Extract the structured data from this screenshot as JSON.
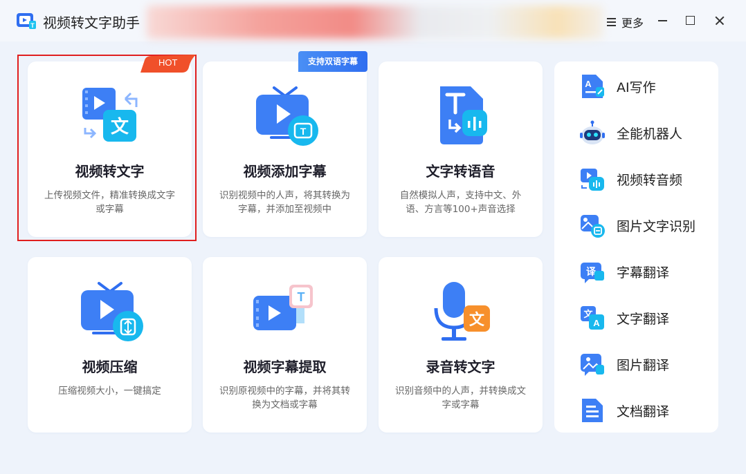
{
  "app": {
    "title": "视频转文字助手",
    "more_label": "更多"
  },
  "cards": [
    {
      "title": "视频转文字",
      "desc": "上传视频文件，精准转换成文字或字幕",
      "badge": "HOT"
    },
    {
      "title": "视频添加字幕",
      "desc": "识别视频中的人声，将其转换为字幕，并添加至视频中",
      "badge": "支持双语字幕"
    },
    {
      "title": "文字转语音",
      "desc": "自然模拟人声，支持中文、外语、方言等100+声音选择"
    },
    {
      "title": "视频压缩",
      "desc": "压缩视频大小，一键搞定"
    },
    {
      "title": "视频字幕提取",
      "desc": "识别原视频中的字幕，并将其转换为文档或字幕"
    },
    {
      "title": "录音转文字",
      "desc": "识别音频中的人声，并转换成文字或字幕"
    }
  ],
  "side_items": [
    {
      "label": "AI写作",
      "icon": "ai-writing-icon"
    },
    {
      "label": "全能机器人",
      "icon": "robot-icon"
    },
    {
      "label": "视频转音频",
      "icon": "video-to-audio-icon"
    },
    {
      "label": "图片文字识别",
      "icon": "image-ocr-icon"
    },
    {
      "label": "字幕翻译",
      "icon": "subtitle-translate-icon"
    },
    {
      "label": "文字翻译",
      "icon": "text-translate-icon"
    },
    {
      "label": "图片翻译",
      "icon": "image-translate-icon"
    },
    {
      "label": "文档翻译",
      "icon": "document-translate-icon"
    }
  ],
  "icon_text": {
    "wen": "文",
    "T": "T",
    "yi": "译",
    "A": "A"
  },
  "colors": {
    "accent": "#2f6ef0",
    "highlight": "#e01e1e",
    "hot": "#f0502a"
  }
}
